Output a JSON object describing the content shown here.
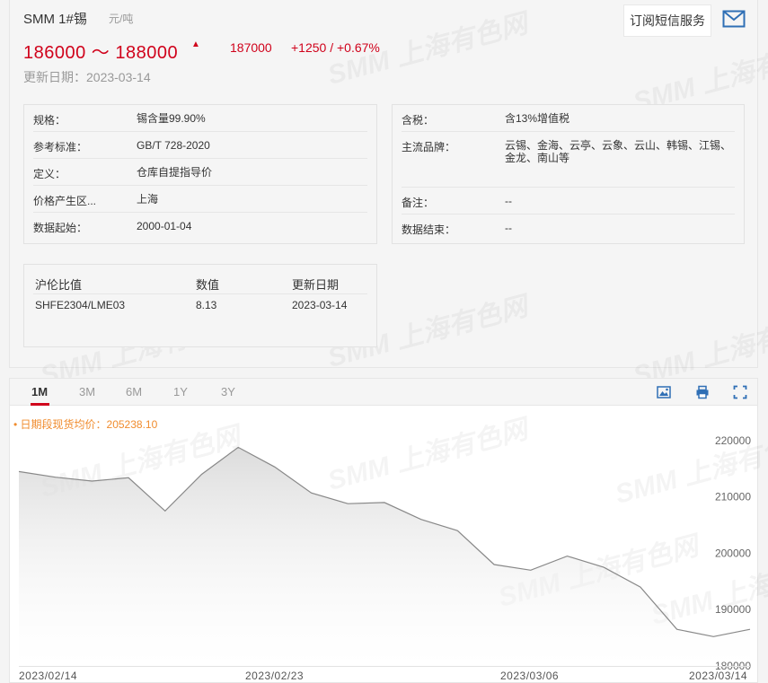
{
  "header": {
    "product": "SMM 1#锡",
    "unit": "元/吨",
    "price_range": "186000 ～ 188000",
    "avg_price": "187000",
    "change": "+1250  /  +0.67%",
    "update_date": "更新日期：2023-03-14",
    "subscribe_label": "订阅短信服务",
    "mail_icon": "mail-icon",
    "trend_icon": "trend-up-icon"
  },
  "specs_left": [
    {
      "label": "规格：",
      "value": "锡含量99.90%"
    },
    {
      "label": "参考标准：",
      "value": "GB/T 728-2020"
    },
    {
      "label": "定义：",
      "value": "仓库自提指导价"
    },
    {
      "label": "价格产生区...",
      "value": "上海"
    },
    {
      "label": "数据起始：",
      "value": "2000-01-04"
    }
  ],
  "specs_right": [
    {
      "label": "含税：",
      "value": "含13%增值税"
    },
    {
      "label": "主流品牌：",
      "value": "云锡、金海、云亭、云象、云山、韩锡、江锡、金龙、南山等"
    },
    {
      "label": "备注：",
      "value": "--"
    },
    {
      "label": "数据结束：",
      "value": "--"
    }
  ],
  "ratio_table": {
    "headers": [
      "沪伦比值",
      "数值",
      "更新日期"
    ],
    "row": [
      "SHFE2304/LME03",
      "8.13",
      "2023-03-14"
    ]
  },
  "chart_tabs": [
    "1M",
    "3M",
    "6M",
    "1Y",
    "3Y"
  ],
  "active_tab": "1M",
  "tools": [
    "image-icon",
    "print-icon",
    "fullscreen-icon"
  ],
  "legend": "• 日期段现货均价：205238.10",
  "watermark": "SMM 上海有色网",
  "colors": {
    "accent": "#d0021b",
    "legend": "#f08c2e",
    "line": "#888888"
  },
  "chart_data": {
    "type": "area",
    "x_labels": [
      "2023/02/14",
      "2023/02/23",
      "2023/03/06",
      "2023/03/14"
    ],
    "y_ticks": [
      180000,
      190000,
      200000,
      210000,
      220000
    ],
    "ylim": [
      180000,
      223000
    ],
    "values": [
      214500,
      213500,
      212800,
      213400,
      207500,
      214000,
      218800,
      215300,
      210700,
      208800,
      209000,
      206000,
      204000,
      198000,
      197000,
      199500,
      197500,
      194000,
      186500,
      185200,
      186500
    ],
    "grid": false
  }
}
